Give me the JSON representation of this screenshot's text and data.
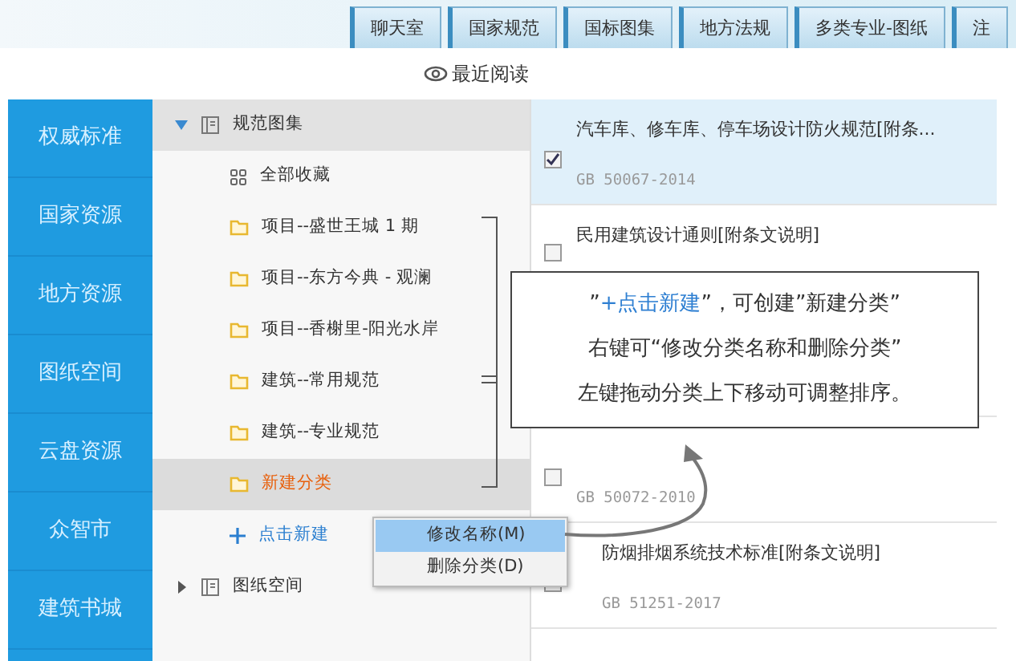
{
  "top_tabs": [
    {
      "label": "聊天室"
    },
    {
      "label": "国家规范"
    },
    {
      "label": "国标图集"
    },
    {
      "label": "地方法规"
    },
    {
      "label": "多类专业-图纸"
    },
    {
      "label": "注"
    }
  ],
  "recent": {
    "label": "最近阅读"
  },
  "sidebar": {
    "items": [
      {
        "label": "权威标准"
      },
      {
        "label": "国家资源"
      },
      {
        "label": "地方资源"
      },
      {
        "label": "图纸空间"
      },
      {
        "label": "云盘资源"
      },
      {
        "label": "众智市"
      },
      {
        "label": "建筑书城"
      }
    ]
  },
  "tree": [
    {
      "label": "规范图集",
      "expanded": true,
      "children": [
        {
          "label": "全部收藏",
          "kind": "all",
          "selected": false
        },
        {
          "label": "项目--盛世王城 1 期",
          "kind": "folder",
          "selected": false
        },
        {
          "label": "项目--东方今典 - 观澜",
          "kind": "folder",
          "selected": false
        },
        {
          "label": "项目--香榭里-阳光水岸",
          "kind": "folder",
          "selected": false
        },
        {
          "label": "建筑--常用规范",
          "kind": "folder",
          "selected": false
        },
        {
          "label": "建筑--专业规范",
          "kind": "folder",
          "selected": false
        },
        {
          "label": "新建分类",
          "kind": "folder",
          "selected": true
        },
        {
          "label": "点击新建",
          "kind": "add",
          "selected": false
        }
      ]
    },
    {
      "label": "图纸空间",
      "expanded": false
    }
  ],
  "list": [
    {
      "title": "汽车库、修车库、停车场设计防火规范[附条...",
      "code": "GB 50067-2014",
      "checked": true,
      "selected": true
    },
    {
      "title": "民用建筑设计通则[附条文说明]",
      "checked": false,
      "selected": false
    },
    {
      "code": "GB 50072-2010",
      "checked": false,
      "selected": false
    },
    {
      "title": "防烟排烟系统技术标准[附条文说明]",
      "code": "GB 51251-2017",
      "checked": false,
      "selected": false
    }
  ],
  "context_menu": [
    {
      "label": "修改名称(M)",
      "selected": true
    },
    {
      "label": "删除分类(D)",
      "selected": false
    }
  ],
  "callout": {
    "lines": [
      [
        {
          "text": "”",
          "highlight": false
        },
        {
          "text": "+点击新建",
          "highlight": true
        },
        {
          "text": "”，可创建”新建分类”",
          "highlight": false
        }
      ],
      [
        {
          "text": "右键可“修改分类名称和删除分类”",
          "highlight": false
        }
      ],
      [
        {
          "text": "左键拖动分类上下移动可调整排序。",
          "highlight": false
        }
      ]
    ]
  }
}
